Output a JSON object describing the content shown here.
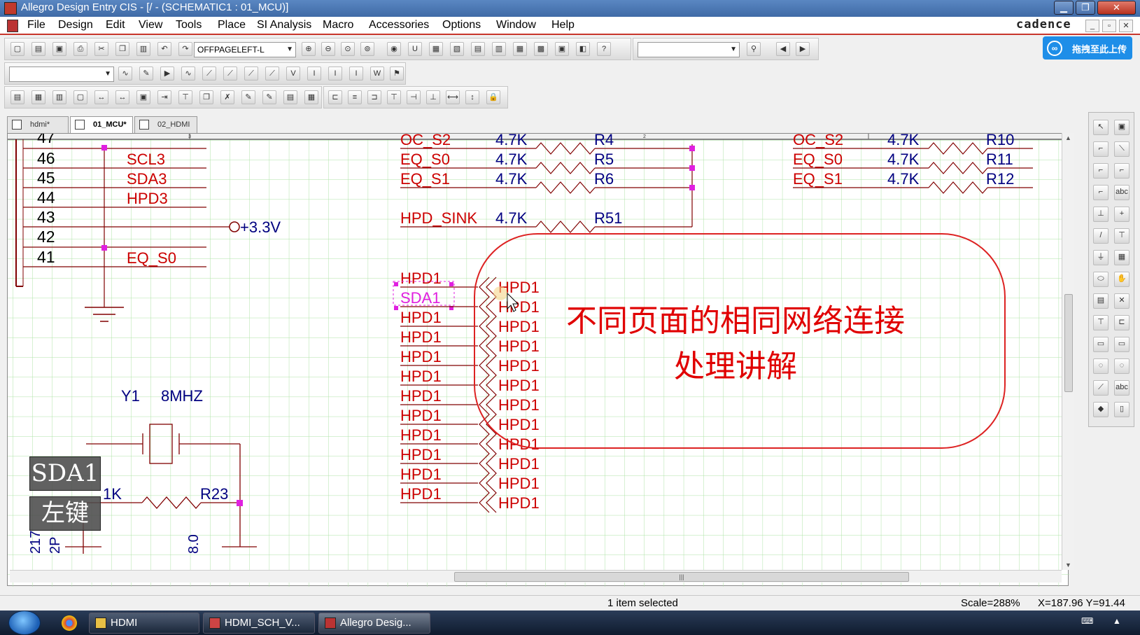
{
  "window": {
    "title": "Allegro Design Entry CIS - [/ - (SCHEMATIC1 : 01_MCU)]",
    "brand": "cadence"
  },
  "menu": [
    "File",
    "Design",
    "Edit",
    "View",
    "Tools",
    "Place",
    "SI Analysis",
    "Macro",
    "Accessories",
    "Options",
    "Window",
    "Help"
  ],
  "toolbar": {
    "part_combo": "OFFPAGELEFT-L",
    "search_combo": "",
    "net_combo": "",
    "upload_label": "拖拽至此上传"
  },
  "tabs": [
    {
      "label": "hdmi*"
    },
    {
      "label": "01_MCU*"
    },
    {
      "label": "02_HDMI"
    }
  ],
  "schematic": {
    "ruler_ticks": [
      "3",
      "2"
    ],
    "pins": [
      "47",
      "46",
      "45",
      "44",
      "43",
      "42",
      "41"
    ],
    "pin_nets": [
      "SCL3",
      "SDA3",
      "HPD3",
      "EQ_S0"
    ],
    "power": "+3.3V",
    "res_mid": [
      {
        "net": "OC_S2",
        "value": "4.7K",
        "ref": "R4"
      },
      {
        "net": "EQ_S0",
        "value": "4.7K",
        "ref": "R5"
      },
      {
        "net": "EQ_S1",
        "value": "4.7K",
        "ref": "R6"
      },
      {
        "net": "HPD_SINK",
        "value": "4.7K",
        "ref": "R51"
      }
    ],
    "res_right": [
      {
        "net": "OC_S2",
        "value": "4.7K",
        "ref": "R10"
      },
      {
        "net": "EQ_S0",
        "value": "4.7K",
        "ref": "R11"
      },
      {
        "net": "EQ_S1",
        "value": "4.7K",
        "ref": "R12"
      }
    ],
    "left_nets": [
      "HPD1",
      "SDA1",
      "HPD1",
      "HPD1",
      "HPD1",
      "HPD1",
      "HPD1",
      "HPD1",
      "HPD1",
      "HPD1",
      "HPD1",
      "HPD1"
    ],
    "offpage": [
      "HPD1",
      "HPD1",
      "HPD1",
      "HPD1",
      "HPD1",
      "HPD1",
      "HPD1",
      "HPD1",
      "HPD1",
      "HPD1",
      "HPD1",
      "HPD1"
    ],
    "crystal_ref": "Y1",
    "crystal_val": "8MHZ",
    "r23_val": "1K",
    "r23_ref": "R23",
    "bottom_labels": [
      "217",
      "2P",
      "8.0"
    ],
    "annotation_line1": "不同页面的相同网络连接",
    "annotation_line2": "处理讲解",
    "badge_top": "SDA1",
    "badge_bottom": "左键"
  },
  "status": {
    "selection": "1 item selected",
    "scale": "Scale=288%",
    "coords": "X=187.96  Y=91.44"
  },
  "taskbar": [
    {
      "label": "HDMI"
    },
    {
      "label": "HDMI_SCH_V..."
    },
    {
      "label": "Allegro Desig..."
    }
  ],
  "colors": {
    "net_red": "#cc0000",
    "wire": "#800000",
    "pin_text": "#000080",
    "selected": "#e020e0",
    "grid": "#aee3a6",
    "annotation": "#e00000"
  }
}
